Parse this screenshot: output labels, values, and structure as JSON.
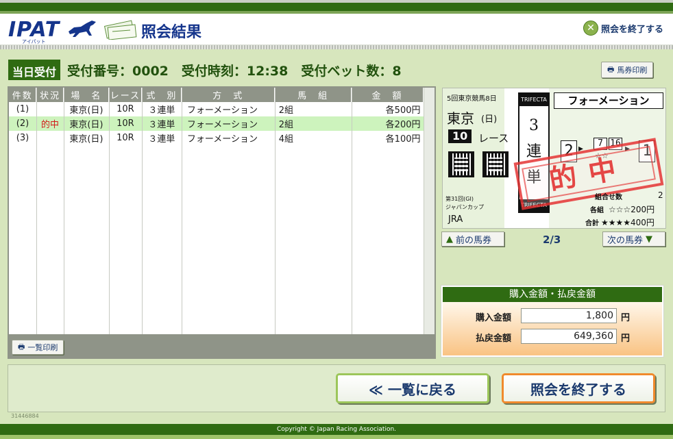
{
  "header": {
    "logo": "IPAT",
    "logo_sub": "アイパット",
    "title": "照会結果",
    "exit_label": "照会を終了する"
  },
  "info": {
    "badge": "当日受付",
    "text": "受付番号：0002　受付時刻：12:38　受付ベット数：8"
  },
  "ticket_print_label": "馬券印刷",
  "table": {
    "headers": [
      "件数",
      "状況",
      "場　名",
      "レース",
      "式　別",
      "方　式",
      "馬　組",
      "金　額"
    ],
    "rows": [
      {
        "no": "(1)",
        "status": "",
        "venue": "東京(日)",
        "race": "10R",
        "type": "３連単",
        "method": "フォーメーション",
        "combo": "2組",
        "amount": "各500円"
      },
      {
        "no": "(2)",
        "status": "的中",
        "venue": "東京(日)",
        "race": "10R",
        "type": "３連単",
        "method": "フォーメーション",
        "combo": "2組",
        "amount": "各200円"
      },
      {
        "no": "(3)",
        "status": "",
        "venue": "東京(日)",
        "race": "10R",
        "type": "３連単",
        "method": "フォーメーション",
        "combo": "4組",
        "amount": "各100円"
      }
    ],
    "print_all_label": "一覧印刷"
  },
  "ticket": {
    "meeting": "5回東京競馬8日",
    "venue": "東京",
    "day": "(日)",
    "race_no": "10",
    "race_label": "レース",
    "trifecta_en": "TRIFECTA",
    "trifecta_jp": [
      "3",
      "連",
      "単"
    ],
    "method": "フォーメーション",
    "first": "2",
    "second_a": "7",
    "second_b": "16",
    "third": "1",
    "stars": "☆☆",
    "event": "第31回(GI)",
    "event_name": "ジャパンカップ",
    "brand": "JRA",
    "combos_label": "組合せ数",
    "combos": "2",
    "each_label": "各組",
    "each_value": "☆☆☆200円",
    "total_label": "合計",
    "total_value": "★★★★400円",
    "stamp": "的中"
  },
  "pager": {
    "prev_label": "前の馬券",
    "next_label": "次の馬券",
    "position": "2/3"
  },
  "amounts": {
    "title": "購入金額・払戻金額",
    "purchase_label": "購入金額",
    "purchase_value": "1,800",
    "refund_label": "払戻金額",
    "refund_value": "649,360",
    "unit": "円"
  },
  "buttons": {
    "back_label": "≪ 一覧に戻る",
    "end_label": "照会を終了する"
  },
  "small_id": "31446884",
  "footer": "Copyright © Japan Racing Association."
}
